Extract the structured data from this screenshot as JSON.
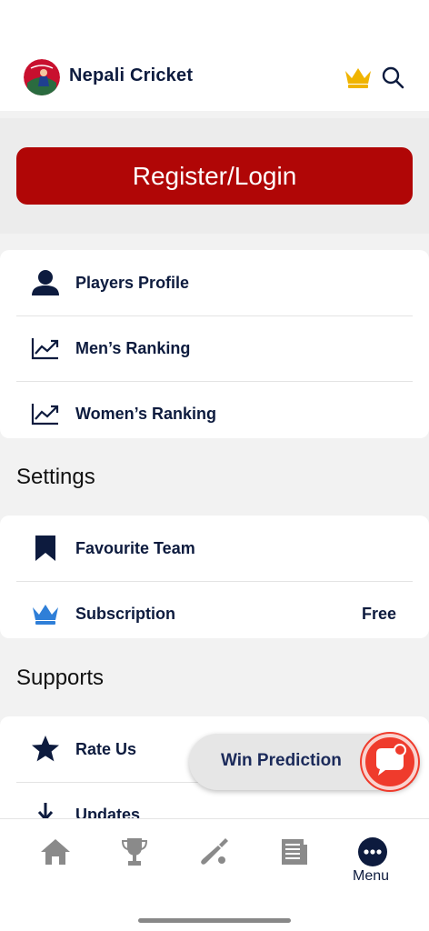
{
  "header": {
    "title": "Nepali Cricket",
    "icons": [
      "app-logo",
      "crown-icon",
      "search-icon"
    ]
  },
  "register": {
    "label": "Register/Login"
  },
  "menu_main": [
    {
      "label": "Players Profile",
      "icon": "person-icon"
    },
    {
      "label": "Men’s Ranking",
      "icon": "trend-chart-icon"
    },
    {
      "label": "Women’s Ranking",
      "icon": "trend-chart-icon"
    }
  ],
  "settings": {
    "title": "Settings",
    "items": [
      {
        "label": "Favourite Team",
        "icon": "bookmark-icon"
      },
      {
        "label": "Subscription",
        "icon": "crown-icon",
        "value": "Free"
      }
    ]
  },
  "supports": {
    "title": "Supports",
    "items": [
      {
        "label": "Rate Us",
        "icon": "star-icon"
      },
      {
        "label": "Updates",
        "icon": "download-icon"
      }
    ]
  },
  "win_prediction": {
    "label": "Win Prediction"
  },
  "bottom_nav": {
    "items": [
      "home-icon",
      "trophy-icon",
      "cricket-bat-icon",
      "news-icon",
      "more-icon"
    ],
    "active_label": "Menu"
  },
  "colors": {
    "brand_red": "#b00606",
    "navy": "#0d1b3e",
    "crown_gold": "#f0b400",
    "crown_blue": "#2f7fd8",
    "prediction_red": "#ef3b2c"
  }
}
